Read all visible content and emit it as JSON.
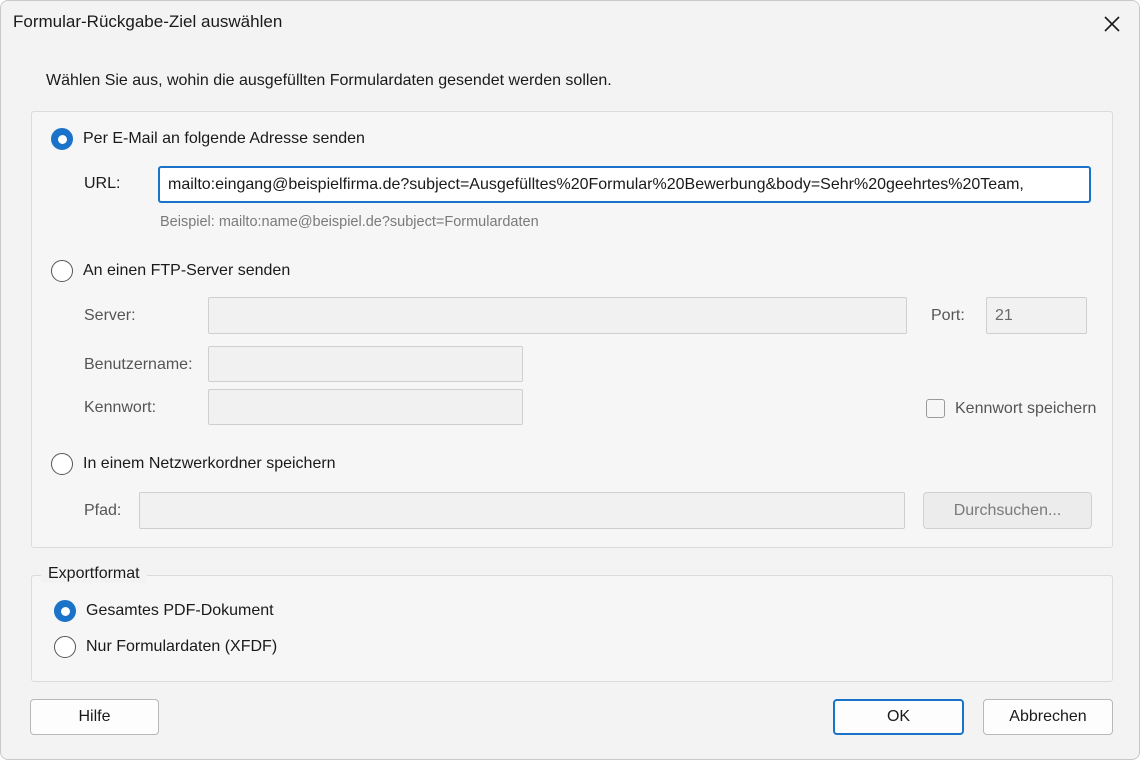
{
  "window": {
    "title": "Formular-Rückgabe-Ziel auswählen",
    "close_icon": "close-icon"
  },
  "intro_text": "Wählen Sie aus, wohin die ausgefüllten Formulardaten gesendet werden sollen.",
  "email_option": {
    "label": "Per E-Mail an folgende Adresse senden",
    "selected": true,
    "url_label": "URL:",
    "url_value": "mailto:eingang@beispielfirma.de?subject=Ausgefülltes%20Formular%20Bewerbung&body=Sehr%20geehrtes%20Team,",
    "example": "Beispiel: mailto:name@beispiel.de?subject=Formulardaten"
  },
  "ftp_option": {
    "label": "An einen FTP-Server senden",
    "selected": false,
    "server_label": "Server:",
    "server_value": "",
    "port_label": "Port:",
    "port_value": "21",
    "username_label": "Benutzername:",
    "username_value": "",
    "password_label": "Kennwort:",
    "password_value": "",
    "save_password_label": "Kennwort speichern",
    "save_password_checked": false
  },
  "network_option": {
    "label": "In einem Netzwerkordner speichern",
    "selected": false,
    "path_label": "Pfad:",
    "path_value": "",
    "browse_label": "Durchsuchen..."
  },
  "export_format": {
    "legend": "Exportformat",
    "options": [
      {
        "label": "Gesamtes PDF-Dokument",
        "selected": true
      },
      {
        "label": "Nur Formulardaten (XFDF)",
        "selected": false
      }
    ]
  },
  "buttons": {
    "help": "Hilfe",
    "ok": "OK",
    "cancel": "Abbrechen"
  },
  "colors": {
    "accent": "#1a73c9",
    "background": "#f3f3f3"
  }
}
